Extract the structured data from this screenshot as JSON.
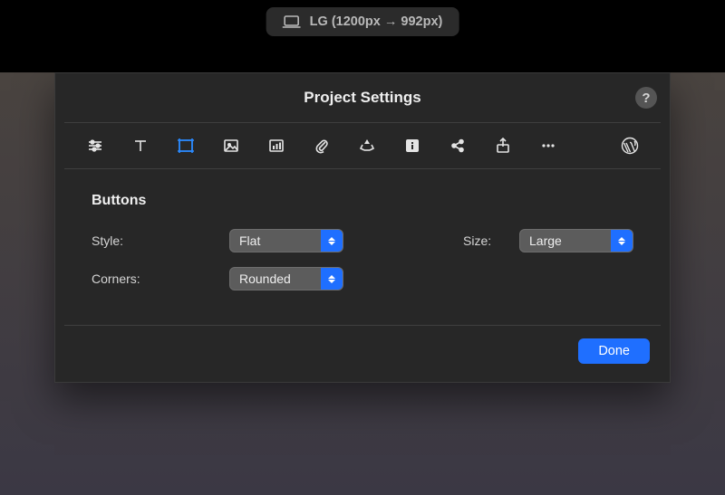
{
  "breakpoint_pill": {
    "label": "LG (1200px → 992px)"
  },
  "dialog": {
    "title": "Project Settings",
    "help_glyph": "?",
    "section_title": "Buttons",
    "fields": {
      "style": {
        "label": "Style:",
        "value": "Flat"
      },
      "size": {
        "label": "Size:",
        "value": "Large"
      },
      "corners": {
        "label": "Corners:",
        "value": "Rounded"
      }
    },
    "done_label": "Done"
  },
  "toolbar_icons": [
    "sliders",
    "text",
    "frame",
    "image",
    "chart",
    "attachment",
    "recycle",
    "info",
    "share",
    "upload",
    "more",
    "wordpress"
  ]
}
